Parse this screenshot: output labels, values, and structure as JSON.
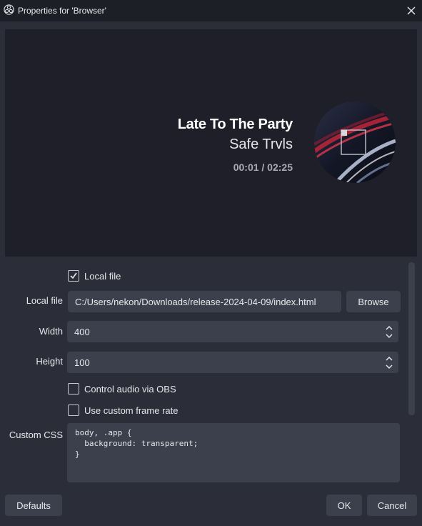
{
  "window": {
    "title": "Properties for 'Browser'",
    "close_icon": "close-icon",
    "app_icon": "obs-logo-icon"
  },
  "preview": {
    "song_title": "Late To The Party",
    "artist": "Safe Trvls",
    "time": "00:01 / 02:25",
    "cover_icon": "album-cover-image"
  },
  "form": {
    "local_file_checkbox": {
      "label": "Local file",
      "checked": true
    },
    "local_file": {
      "label": "Local file",
      "value": "C:/Users/nekon/Downloads/release-2024-04-09/index.html",
      "browse_label": "Browse"
    },
    "width": {
      "label": "Width",
      "value": "400"
    },
    "height": {
      "label": "Height",
      "value": "100"
    },
    "control_audio": {
      "label": "Control audio via OBS",
      "checked": false
    },
    "custom_frame_rate": {
      "label": "Use custom frame rate",
      "checked": false
    },
    "custom_css": {
      "label": "Custom CSS",
      "lines": [
        "body, .app {",
        "  background: transparent;",
        "}"
      ]
    }
  },
  "footer": {
    "defaults_label": "Defaults",
    "ok_label": "OK",
    "cancel_label": "Cancel"
  },
  "colors": {
    "background": "#2b2e38",
    "titlebar": "#1d1f26",
    "preview_bg": "#1e1f29",
    "field_bg": "#3c404d"
  }
}
